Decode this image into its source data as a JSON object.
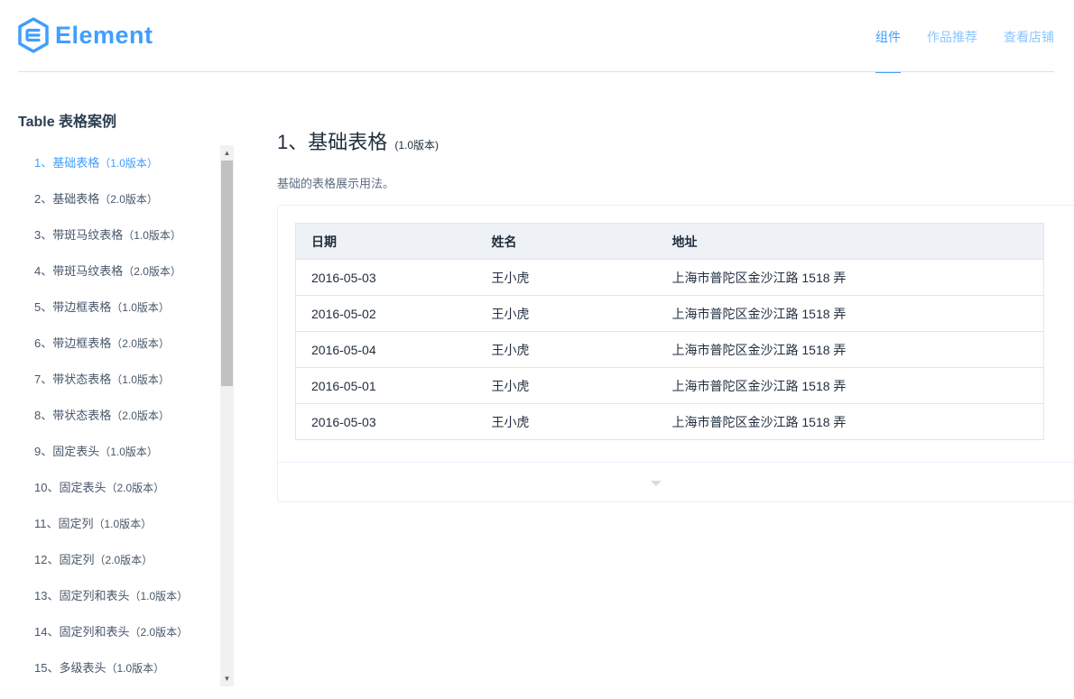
{
  "header": {
    "logo_text": "Element",
    "nav": [
      {
        "label": "组件",
        "active": true
      },
      {
        "label": "作品推荐",
        "active": false
      },
      {
        "label": "查看店铺",
        "active": false
      }
    ],
    "accent_color": "#409eff"
  },
  "sidebar": {
    "title": "Table 表格案例",
    "items": [
      {
        "label": "1、基础表格",
        "version": "（1.0版本）",
        "active": true
      },
      {
        "label": "2、基础表格",
        "version": "（2.0版本）"
      },
      {
        "label": "3、带斑马纹表格",
        "version": "（1.0版本）"
      },
      {
        "label": "4、带斑马纹表格",
        "version": "（2.0版本）"
      },
      {
        "label": "5、带边框表格",
        "version": "（1.0版本）"
      },
      {
        "label": "6、带边框表格",
        "version": "（2.0版本）"
      },
      {
        "label": "7、带状态表格",
        "version": "（1.0版本）"
      },
      {
        "label": "8、带状态表格",
        "version": "（2.0版本）"
      },
      {
        "label": "9、固定表头",
        "version": "（1.0版本）"
      },
      {
        "label": "10、固定表头",
        "version": "（2.0版本）"
      },
      {
        "label": "11、固定列",
        "version": "（1.0版本）"
      },
      {
        "label": "12、固定列",
        "version": "（2.0版本）"
      },
      {
        "label": "13、固定列和表头",
        "version": "（1.0版本）"
      },
      {
        "label": "14、固定列和表头",
        "version": "（2.0版本）"
      },
      {
        "label": "15、多级表头",
        "version": "（1.0版本）"
      }
    ]
  },
  "main": {
    "title": "1、基础表格",
    "title_version": "(1.0版本)",
    "description": "基础的表格展示用法。",
    "table": {
      "columns": [
        "日期",
        "姓名",
        "地址"
      ],
      "rows": [
        [
          "2016-05-03",
          "王小虎",
          "上海市普陀区金沙江路 1518 弄"
        ],
        [
          "2016-05-02",
          "王小虎",
          "上海市普陀区金沙江路 1518 弄"
        ],
        [
          "2016-05-04",
          "王小虎",
          "上海市普陀区金沙江路 1518 弄"
        ],
        [
          "2016-05-01",
          "王小虎",
          "上海市普陀区金沙江路 1518 弄"
        ],
        [
          "2016-05-03",
          "王小虎",
          "上海市普陀区金沙江路 1518 弄"
        ]
      ]
    },
    "expand_icon": "caret-down-icon"
  }
}
